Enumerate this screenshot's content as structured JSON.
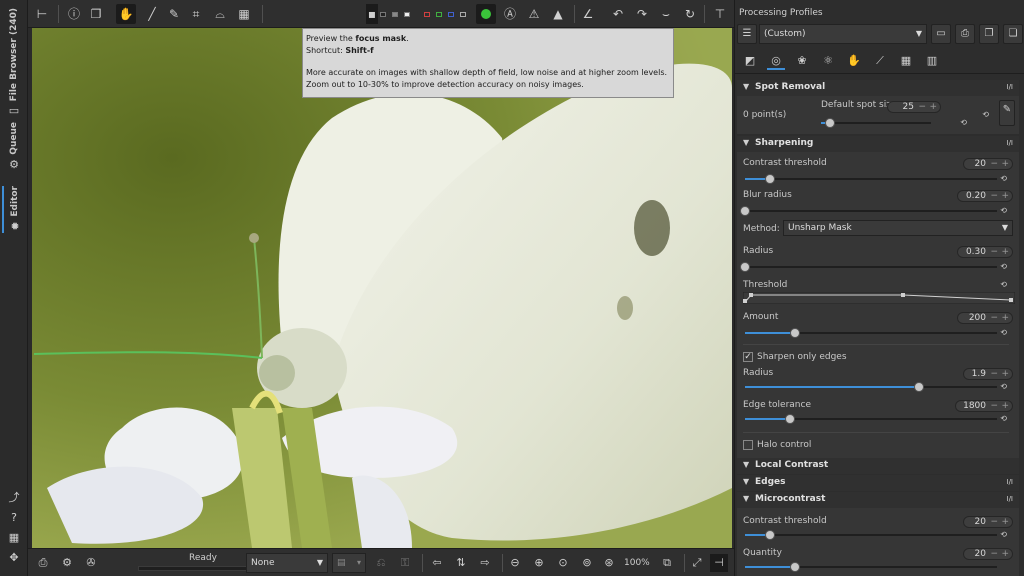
{
  "sidebar": {
    "tabs": [
      {
        "label": "File Browser (240)",
        "icon": "folder-icon"
      },
      {
        "label": "Queue",
        "icon": "gears-icon"
      },
      {
        "label": "Editor",
        "icon": "editor-icon"
      }
    ],
    "bottom_icons": [
      "graph-icon",
      "help-icon",
      "keyboard-icon",
      "move-icon"
    ]
  },
  "toolbar": {
    "icons": [
      "history-icon",
      "info-icon",
      "snapshot-icon",
      "hand-icon",
      "picker-icon",
      "wb-picker-icon",
      "crop-icon",
      "straighten-icon",
      "perspective-icon",
      "bg-color-icon",
      "focus-mask-icon",
      "clip-high-icon",
      "warning-icon",
      "warning2-icon",
      "histogram-icon",
      "rotate-left-icon",
      "rotate-right-icon",
      "flip-h-icon",
      "flip-v-icon",
      "tool-panel-icon"
    ]
  },
  "tooltip": {
    "line1_pre": "Preview the ",
    "line1_bold": "focus mask",
    "line1_post": ".",
    "line2_pre": "Shortcut: ",
    "line2_bold": "Shift-f",
    "line3": "More accurate on images with shallow depth of field, low noise and at higher zoom levels.",
    "line4": "Zoom out to 10-30% to improve detection accuracy on noisy images."
  },
  "bottombar": {
    "status": "Ready",
    "profile_select": "None",
    "zoom": "100%"
  },
  "panel": {
    "title": "Processing Profiles",
    "profile": "(Custom)"
  },
  "spot_removal": {
    "title": "Spot Removal",
    "onoff": "I/I",
    "points": "0 point(s)",
    "default_spot_label": "Default spot size",
    "default_spot_value": "25",
    "slider_fraction": 0.08
  },
  "sharpening": {
    "title": "Sharpening",
    "onoff": "I/I",
    "contrast_label": "Contrast threshold",
    "contrast_value": "20",
    "contrast_fraction": 0.1,
    "blur_label": "Blur radius",
    "blur_value": "0.20",
    "blur_fraction": 0.0,
    "method_label": "Method:",
    "method_value": "Unsharp Mask",
    "radius_label": "Radius",
    "radius_value": "0.30",
    "radius_fraction": 0.0,
    "threshold_label": "Threshold",
    "amount_label": "Amount",
    "amount_value": "200",
    "amount_fraction": 0.2,
    "edges_label": "Sharpen only edges",
    "edges_radius_label": "Radius",
    "edges_radius_value": "1.9",
    "edges_radius_fraction": 0.69,
    "tolerance_label": "Edge tolerance",
    "tolerance_value": "1800",
    "tolerance_fraction": 0.18,
    "halo_label": "Halo control"
  },
  "local_contrast": {
    "title": "Local Contrast"
  },
  "edges": {
    "title": "Edges",
    "onoff": "I/I"
  },
  "microcontrast": {
    "title": "Microcontrast",
    "onoff": "I/I",
    "contrast_label": "Contrast threshold",
    "contrast_value": "20",
    "contrast_fraction": 0.1,
    "quantity_label": "Quantity",
    "quantity_value": "20",
    "quantity_fraction": 0.2
  }
}
